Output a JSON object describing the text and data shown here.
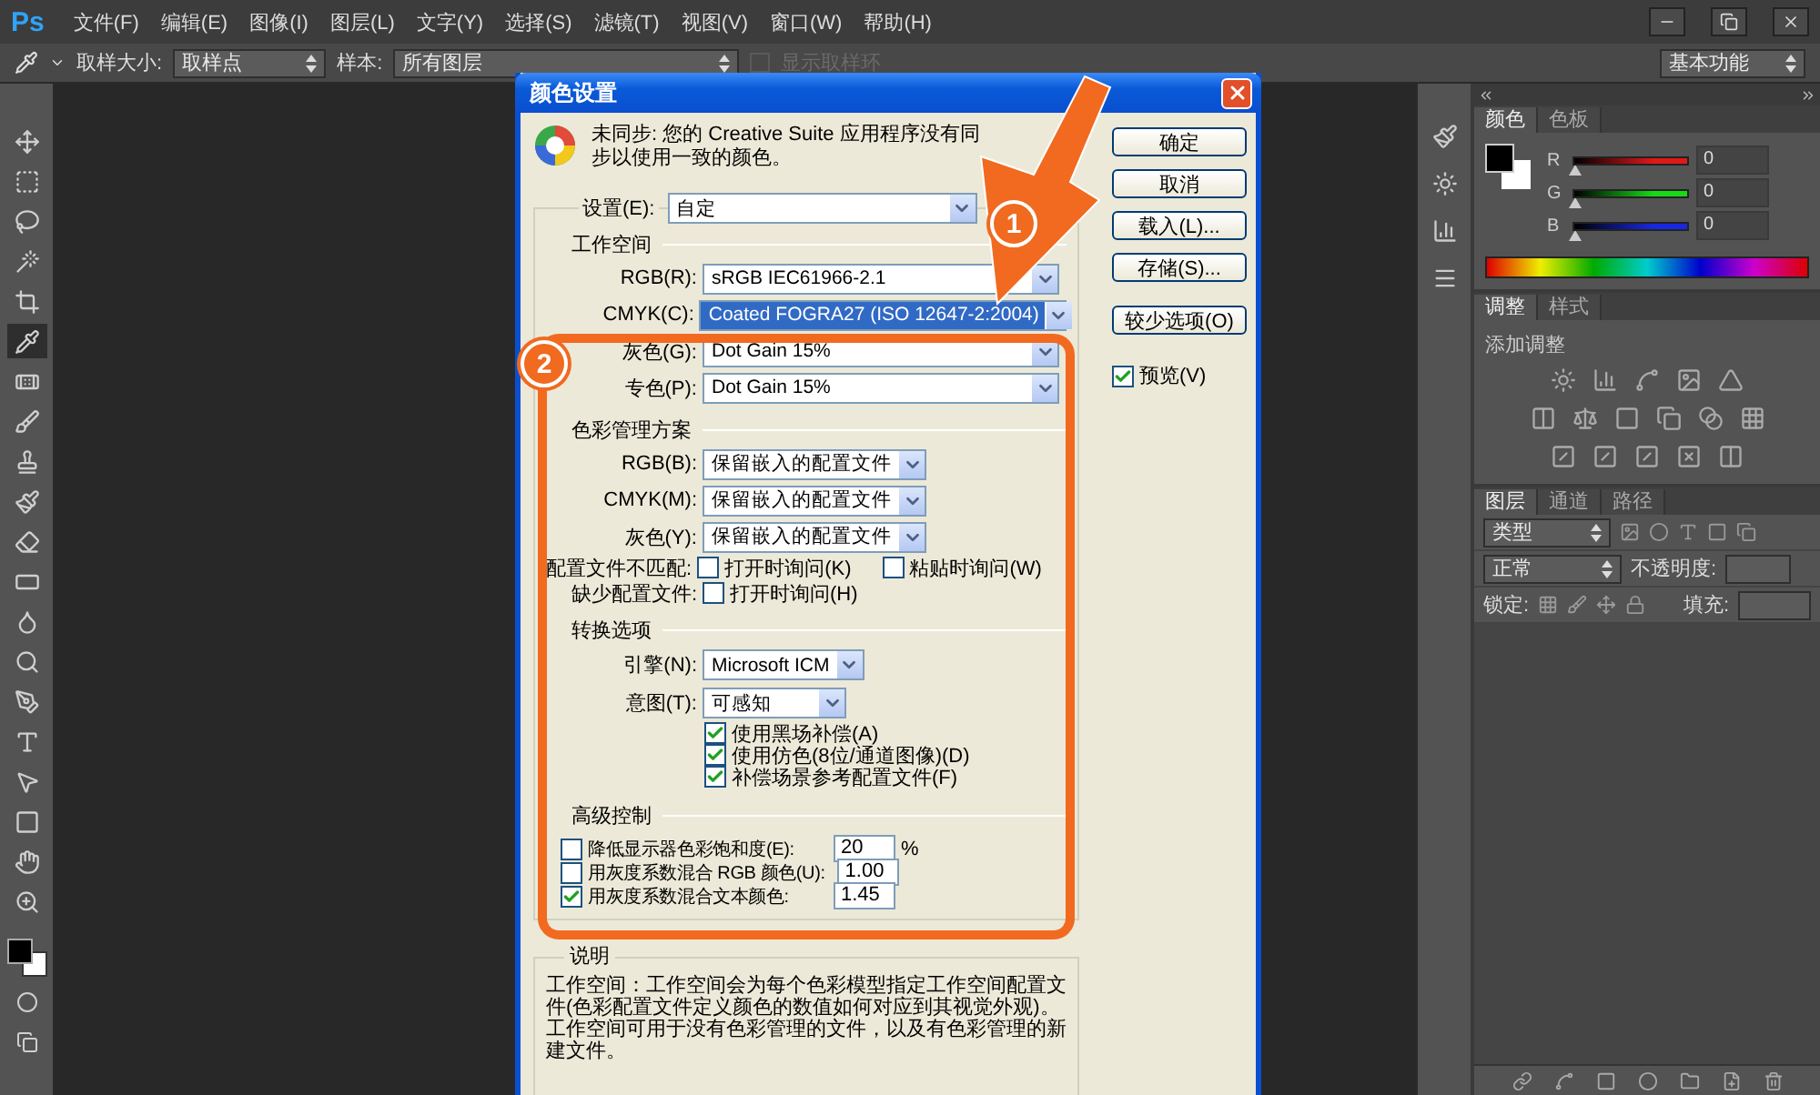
{
  "app": {
    "logo": "Ps"
  },
  "menu": [
    "文件(F)",
    "编辑(E)",
    "图像(I)",
    "图层(L)",
    "文字(Y)",
    "选择(S)",
    "滤镜(T)",
    "视图(V)",
    "窗口(W)",
    "帮助(H)"
  ],
  "options_bar": {
    "sample_size_label": "取样大小:",
    "sample_size": "取样点",
    "sample_label": "样本:",
    "sample": "所有图层",
    "show_ring": {
      "label": "显示取样环",
      "checked": false,
      "disabled": true
    },
    "workspace": "基本功能"
  },
  "tools": [
    {
      "kind": "move",
      "selected": false
    },
    {
      "kind": "marquee",
      "selected": false
    },
    {
      "kind": "lasso",
      "selected": false
    },
    {
      "kind": "wand",
      "selected": false
    },
    {
      "kind": "crop",
      "selected": false
    },
    {
      "kind": "eyedropper",
      "selected": true
    },
    {
      "kind": "heal",
      "selected": false
    },
    {
      "kind": "brush",
      "selected": false
    },
    {
      "kind": "stamp",
      "selected": false
    },
    {
      "kind": "history",
      "selected": false
    },
    {
      "kind": "eraser",
      "selected": false
    },
    {
      "kind": "gradient",
      "selected": false
    },
    {
      "kind": "blur",
      "selected": false
    },
    {
      "kind": "dodge",
      "selected": false
    },
    {
      "kind": "pen",
      "selected": false
    },
    {
      "kind": "type",
      "selected": false
    },
    {
      "kind": "select",
      "selected": false
    },
    {
      "kind": "shape",
      "selected": false
    },
    {
      "kind": "hand",
      "selected": false
    },
    {
      "kind": "zoom",
      "selected": false
    }
  ],
  "dialog": {
    "title": "颜色设置",
    "message": "未同步: 您的 Creative Suite 应用程序没有同步以使用一致的颜色。",
    "settings": {
      "label": "设置(E):",
      "value": "自定"
    },
    "working_spaces": {
      "title": "工作空间",
      "rows": [
        {
          "label": "RGB(R):",
          "value": "sRGB IEC61966-2.1",
          "selected": false
        },
        {
          "label": "CMYK(C):",
          "value": "Coated FOGRA27 (ISO 12647-2:2004)",
          "selected": true
        },
        {
          "label": "灰色(G):",
          "value": "Dot Gain 15%",
          "selected": false
        },
        {
          "label": "专色(P):",
          "value": "Dot Gain 15%",
          "selected": false
        }
      ]
    },
    "policies": {
      "title": "色彩管理方案",
      "rows": [
        {
          "label": "RGB(B):",
          "value": "保留嵌入的配置文件"
        },
        {
          "label": "CMYK(M):",
          "value": "保留嵌入的配置文件"
        },
        {
          "label": "灰色(Y):",
          "value": "保留嵌入的配置文件"
        }
      ],
      "mismatch_label": "配置文件不匹配:",
      "mismatch": [
        {
          "label": "打开时询问(K)",
          "checked": false
        },
        {
          "label": "粘贴时询问(W)",
          "checked": false
        }
      ],
      "missing_label": "缺少配置文件:",
      "missing": [
        {
          "label": "打开时询问(H)",
          "checked": false
        }
      ]
    },
    "conversion": {
      "title": "转换选项",
      "rows": [
        {
          "label": "引擎(N):",
          "value": "Microsoft ICM"
        },
        {
          "label": "意图(T):",
          "value": "可感知"
        }
      ],
      "options": [
        {
          "label": "使用黑场补偿(A)",
          "checked": true
        },
        {
          "label": "使用仿色(8位/通道图像)(D)",
          "checked": true
        },
        {
          "label": "补偿场景参考配置文件(F)",
          "checked": true
        }
      ]
    },
    "advanced": {
      "title": "高级控制",
      "rows": [
        {
          "label": "降低显示器色彩饱和度(E):",
          "checked": false,
          "value": "20",
          "unit": "%"
        },
        {
          "label": "用灰度系数混合 RGB 颜色(U):",
          "checked": false,
          "value": "1.00"
        },
        {
          "label": "用灰度系数混合文本颜色:",
          "checked": true,
          "value": "1.45"
        }
      ]
    },
    "description": {
      "title": "说明",
      "text": "工作空间：工作空间会为每个色彩模型指定工作空间配置文件(色彩配置文件定义颜色的数值如何对应到其视觉外观)。工作空间可用于没有色彩管理的文件，以及有色彩管理的新建文件。"
    },
    "buttons": [
      "确定",
      "取消",
      "载入(L)...",
      "存储(S)...",
      "较少选项(O)"
    ],
    "preview": {
      "label": "预览(V)",
      "checked": true
    }
  },
  "annotations": [
    {
      "kind": "arrow",
      "number": "1"
    },
    {
      "kind": "frame",
      "number": "2"
    }
  ],
  "panels": {
    "color": {
      "tabs": [
        {
          "label": "颜色",
          "selected": true
        },
        {
          "label": "色板",
          "selected": false
        }
      ],
      "channels": [
        {
          "name": "R",
          "value": "0",
          "level": 0,
          "color": "#e01818"
        },
        {
          "name": "G",
          "value": "0",
          "level": 0,
          "color": "#18d818"
        },
        {
          "name": "B",
          "value": "0",
          "level": 0,
          "color": "#1828e0"
        }
      ]
    },
    "adjustments": {
      "tabs": [
        {
          "label": "调整",
          "selected": true
        },
        {
          "label": "样式",
          "selected": false
        }
      ],
      "title": "添加调整"
    },
    "layers": {
      "tabs": [
        {
          "label": "图层",
          "selected": true
        },
        {
          "label": "通道",
          "selected": false
        },
        {
          "label": "路径",
          "selected": false
        }
      ],
      "filter": "类型",
      "blend": "正常",
      "opacity_label": "不透明度:",
      "lock_label": "锁定:",
      "fill_label": "填充:"
    }
  }
}
